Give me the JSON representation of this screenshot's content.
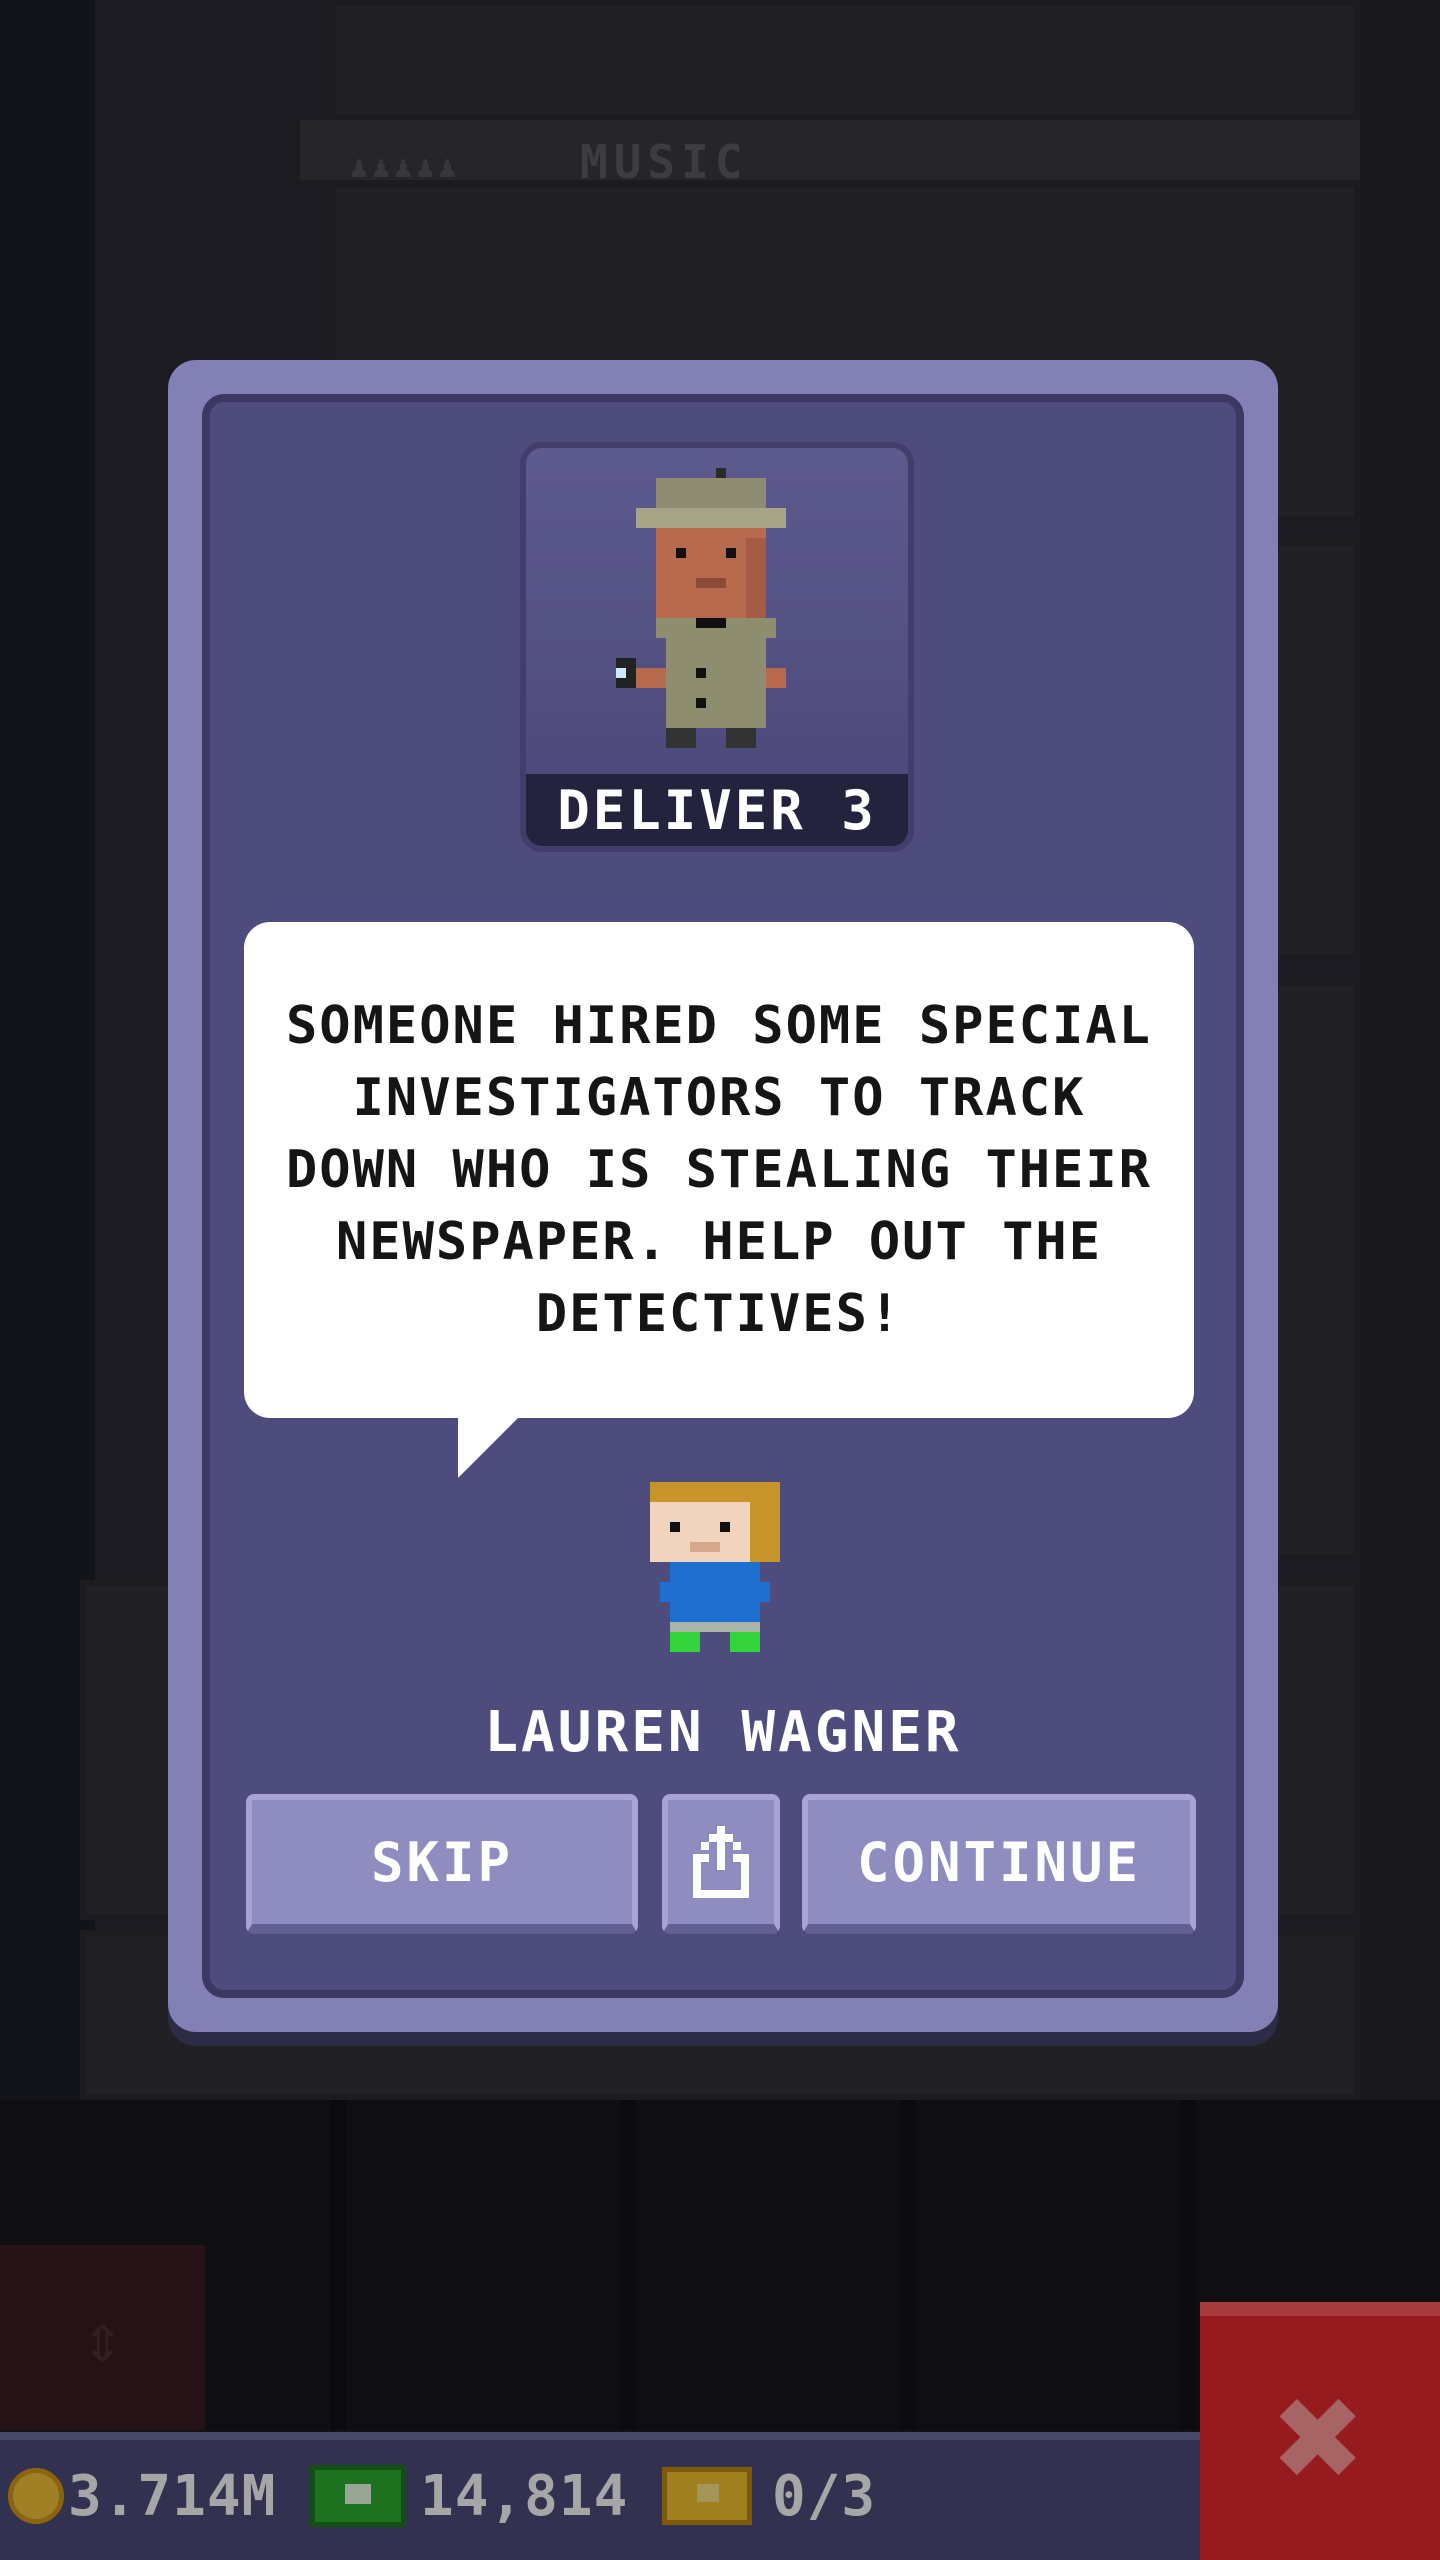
{
  "background": {
    "floor_label": "MUSIC",
    "floor_dots": "♟♟♟♟♟"
  },
  "event_dialog": {
    "mission_badge": "DELIVER 3",
    "story_text": "SOMEONE HIRED SOME SPECIAL INVESTIGATORS TO TRACK DOWN WHO IS STEALING THEIR NEWSPAPER. HELP OUT THE DETECTIVES!",
    "guest_name": "LAUREN WAGNER",
    "buttons": {
      "skip": "SKIP",
      "share_icon": "share-icon",
      "continue": "CONTINUE"
    }
  },
  "status_bar": {
    "coins": "3.714M",
    "tower_bux": "14,814",
    "tickets": "0/3",
    "close_icon": "close-icon"
  },
  "colors": {
    "dialog_frame": "#8380b6",
    "dialog_panel": "#4e4b7d",
    "close_button": "#e72a2e",
    "coin": "#f7c53a",
    "bux": "#2fae2f"
  }
}
